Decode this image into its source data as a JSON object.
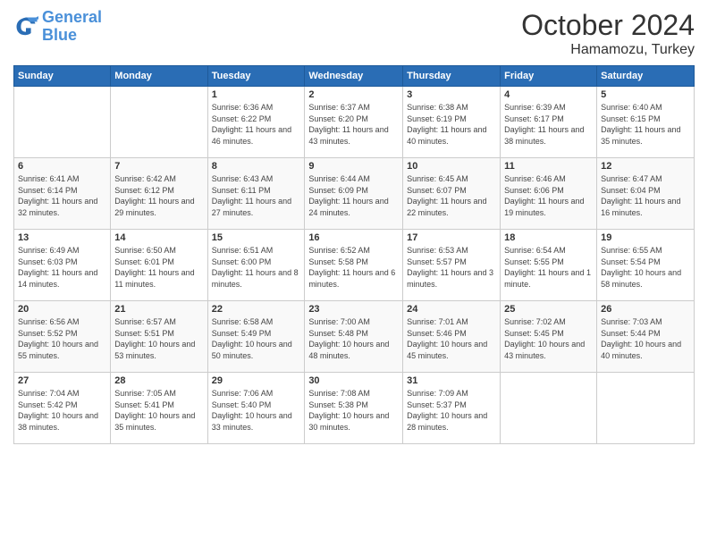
{
  "header": {
    "logo_line1": "General",
    "logo_line2": "Blue",
    "title": "October 2024",
    "location": "Hamamozu, Turkey"
  },
  "weekdays": [
    "Sunday",
    "Monday",
    "Tuesday",
    "Wednesday",
    "Thursday",
    "Friday",
    "Saturday"
  ],
  "weeks": [
    [
      null,
      null,
      {
        "day": "1",
        "sunrise": "6:36 AM",
        "sunset": "6:22 PM",
        "daylight": "11 hours and 46 minutes."
      },
      {
        "day": "2",
        "sunrise": "6:37 AM",
        "sunset": "6:20 PM",
        "daylight": "11 hours and 43 minutes."
      },
      {
        "day": "3",
        "sunrise": "6:38 AM",
        "sunset": "6:19 PM",
        "daylight": "11 hours and 40 minutes."
      },
      {
        "day": "4",
        "sunrise": "6:39 AM",
        "sunset": "6:17 PM",
        "daylight": "11 hours and 38 minutes."
      },
      {
        "day": "5",
        "sunrise": "6:40 AM",
        "sunset": "6:15 PM",
        "daylight": "11 hours and 35 minutes."
      }
    ],
    [
      {
        "day": "6",
        "sunrise": "6:41 AM",
        "sunset": "6:14 PM",
        "daylight": "11 hours and 32 minutes."
      },
      {
        "day": "7",
        "sunrise": "6:42 AM",
        "sunset": "6:12 PM",
        "daylight": "11 hours and 29 minutes."
      },
      {
        "day": "8",
        "sunrise": "6:43 AM",
        "sunset": "6:11 PM",
        "daylight": "11 hours and 27 minutes."
      },
      {
        "day": "9",
        "sunrise": "6:44 AM",
        "sunset": "6:09 PM",
        "daylight": "11 hours and 24 minutes."
      },
      {
        "day": "10",
        "sunrise": "6:45 AM",
        "sunset": "6:07 PM",
        "daylight": "11 hours and 22 minutes."
      },
      {
        "day": "11",
        "sunrise": "6:46 AM",
        "sunset": "6:06 PM",
        "daylight": "11 hours and 19 minutes."
      },
      {
        "day": "12",
        "sunrise": "6:47 AM",
        "sunset": "6:04 PM",
        "daylight": "11 hours and 16 minutes."
      }
    ],
    [
      {
        "day": "13",
        "sunrise": "6:49 AM",
        "sunset": "6:03 PM",
        "daylight": "11 hours and 14 minutes."
      },
      {
        "day": "14",
        "sunrise": "6:50 AM",
        "sunset": "6:01 PM",
        "daylight": "11 hours and 11 minutes."
      },
      {
        "day": "15",
        "sunrise": "6:51 AM",
        "sunset": "6:00 PM",
        "daylight": "11 hours and 8 minutes."
      },
      {
        "day": "16",
        "sunrise": "6:52 AM",
        "sunset": "5:58 PM",
        "daylight": "11 hours and 6 minutes."
      },
      {
        "day": "17",
        "sunrise": "6:53 AM",
        "sunset": "5:57 PM",
        "daylight": "11 hours and 3 minutes."
      },
      {
        "day": "18",
        "sunrise": "6:54 AM",
        "sunset": "5:55 PM",
        "daylight": "11 hours and 1 minute."
      },
      {
        "day": "19",
        "sunrise": "6:55 AM",
        "sunset": "5:54 PM",
        "daylight": "10 hours and 58 minutes."
      }
    ],
    [
      {
        "day": "20",
        "sunrise": "6:56 AM",
        "sunset": "5:52 PM",
        "daylight": "10 hours and 55 minutes."
      },
      {
        "day": "21",
        "sunrise": "6:57 AM",
        "sunset": "5:51 PM",
        "daylight": "10 hours and 53 minutes."
      },
      {
        "day": "22",
        "sunrise": "6:58 AM",
        "sunset": "5:49 PM",
        "daylight": "10 hours and 50 minutes."
      },
      {
        "day": "23",
        "sunrise": "7:00 AM",
        "sunset": "5:48 PM",
        "daylight": "10 hours and 48 minutes."
      },
      {
        "day": "24",
        "sunrise": "7:01 AM",
        "sunset": "5:46 PM",
        "daylight": "10 hours and 45 minutes."
      },
      {
        "day": "25",
        "sunrise": "7:02 AM",
        "sunset": "5:45 PM",
        "daylight": "10 hours and 43 minutes."
      },
      {
        "day": "26",
        "sunrise": "7:03 AM",
        "sunset": "5:44 PM",
        "daylight": "10 hours and 40 minutes."
      }
    ],
    [
      {
        "day": "27",
        "sunrise": "7:04 AM",
        "sunset": "5:42 PM",
        "daylight": "10 hours and 38 minutes."
      },
      {
        "day": "28",
        "sunrise": "7:05 AM",
        "sunset": "5:41 PM",
        "daylight": "10 hours and 35 minutes."
      },
      {
        "day": "29",
        "sunrise": "7:06 AM",
        "sunset": "5:40 PM",
        "daylight": "10 hours and 33 minutes."
      },
      {
        "day": "30",
        "sunrise": "7:08 AM",
        "sunset": "5:38 PM",
        "daylight": "10 hours and 30 minutes."
      },
      {
        "day": "31",
        "sunrise": "7:09 AM",
        "sunset": "5:37 PM",
        "daylight": "10 hours and 28 minutes."
      },
      null,
      null
    ]
  ],
  "labels": {
    "sunrise": "Sunrise:",
    "sunset": "Sunset:",
    "daylight": "Daylight:"
  },
  "colors": {
    "header_bg": "#2a6db5",
    "accent": "#4a90d9"
  }
}
